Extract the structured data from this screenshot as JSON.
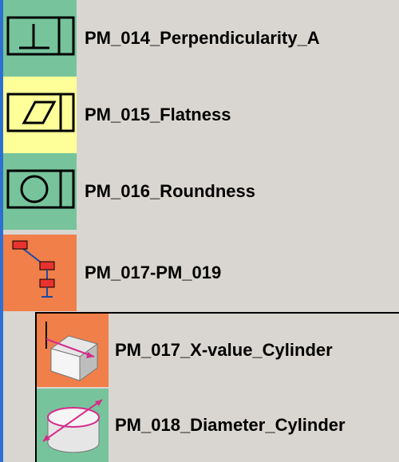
{
  "colors": {
    "green_tile": "#77c49c",
    "yellow_tile": "#ffff9a",
    "orange_tile": "#f07f4a",
    "background": "#d9d6d1",
    "left_strip": "#2d6fd2",
    "red_node": "#e8322f"
  },
  "items": [
    {
      "label": "PM_014_Perpendicularity_A",
      "icon": "perpendicularity-icon"
    },
    {
      "label": "PM_015_Flatness",
      "icon": "flatness-icon"
    },
    {
      "label": "PM_016_Roundness",
      "icon": "roundness-icon"
    },
    {
      "label": "PM_017-PM_019",
      "icon": "tree-group-icon"
    }
  ],
  "children": [
    {
      "label": "PM_017_X-value_Cylinder",
      "icon": "x-value-cylinder-icon"
    },
    {
      "label": "PM_018_Diameter_Cylinder",
      "icon": "diameter-cylinder-icon"
    }
  ]
}
